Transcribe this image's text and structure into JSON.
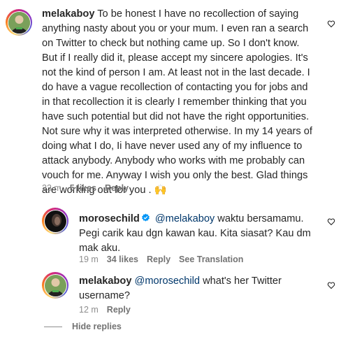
{
  "comments": [
    {
      "username": "melakaboy",
      "lines": [
        "To be honest I have no recollection of saying",
        "anything nasty about you or your mum. I even ran a search",
        "on Twitter to check but nothing came up. So I don't know.",
        "But if I really did it, please accept my sincere apologies. It's",
        "not the kind of person I am. At least not in the last decade. I",
        "do have a vague recollection of contacting you for jobs and",
        "in that recollection it is clearly I remember thinking that you",
        "have such potential but did not have the right opportunities.",
        "Not sure why it was interpreted otherwise. In my 14 years of",
        "doing what I do, Ii have never used any of my influence to",
        "attack anybody. Anybody who works with me probably can",
        "vouch for me. Anyway I wish you only the best. Glad things",
        "are working out for you . 🙌"
      ],
      "time": "23 m",
      "likes": "5 likes",
      "reply_label": "Reply"
    },
    {
      "username": "morosechild",
      "mention": "@melakaboy",
      "lines": [
        " waktu bersamamu.",
        "Pegi carik kau dgn kawan kau. Kita siasat? Kau dm",
        "mak aku."
      ],
      "time": "19 m",
      "likes": "34 likes",
      "reply_label": "Reply",
      "translation_label": "See Translation"
    },
    {
      "username": "melakaboy",
      "mention": "@morosechild",
      "lines": [
        " what's her Twitter",
        "username?"
      ],
      "time": "12 m",
      "reply_label": "Reply"
    }
  ],
  "hide_replies_label": "Hide replies",
  "icons": {
    "like": "heart-outline-icon",
    "verified": "verified-badge-icon"
  },
  "colors": {
    "text": "#262626",
    "meta": "#8e8e8e",
    "mention": "#00376b",
    "verified": "#0095f6"
  }
}
